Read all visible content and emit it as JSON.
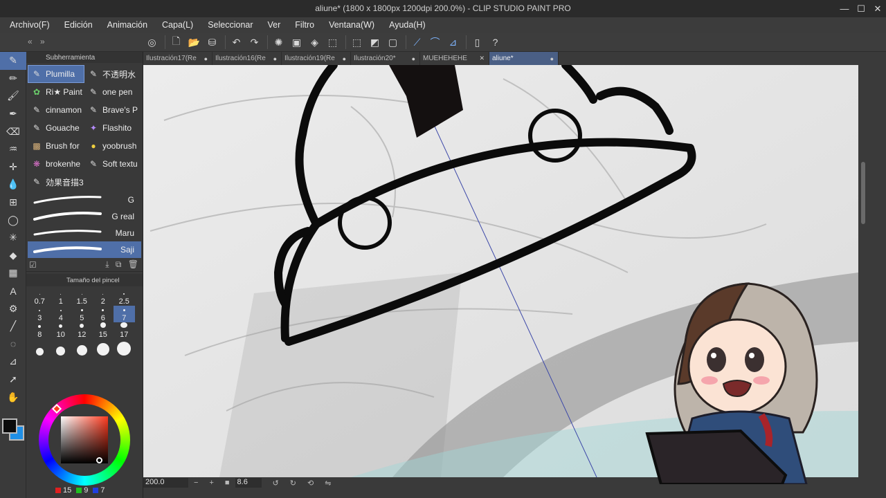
{
  "window": {
    "title": "aliune* (1800 x 1800px 1200dpi 200.0%)  - CLIP STUDIO PAINT PRO",
    "controls": [
      "—",
      "☐",
      "✕"
    ]
  },
  "menubar": [
    "Archivo(F)",
    "Edición",
    "Animación",
    "Capa(L)",
    "Seleccionar",
    "Ver",
    "Filtro",
    "Ventana(W)",
    "Ayuda(H)"
  ],
  "commandbar": {
    "nav": "« »"
  },
  "subtool_panel": {
    "header": "Subherramienta",
    "subtools": [
      {
        "label": "Plumilla",
        "icon": "pen-icon",
        "active": true
      },
      {
        "label": "不透明水",
        "icon": "pen-icon"
      },
      {
        "label": "Ri★ Paint",
        "icon": "leaf-icon"
      },
      {
        "label": "one pen",
        "icon": "pen-icon"
      },
      {
        "label": "cinnamon",
        "icon": "pen-icon"
      },
      {
        "label": "Brave's P",
        "icon": "pen-icon"
      },
      {
        "label": "Gouache",
        "icon": "pen-icon"
      },
      {
        "label": "Flashito",
        "icon": "sparkle-icon"
      },
      {
        "label": "Brush for",
        "icon": "brush-icon"
      },
      {
        "label": "yoobrush",
        "icon": "circle-icon"
      },
      {
        "label": "brokenhe",
        "icon": "heart-icon"
      },
      {
        "label": "Soft textu",
        "icon": "pen-icon"
      },
      {
        "label": "効果音描3",
        "icon": "pen-icon"
      }
    ],
    "strokes": [
      {
        "label": "G"
      },
      {
        "label": "G real"
      },
      {
        "label": "Maru"
      },
      {
        "label": "Saji",
        "active": true
      }
    ]
  },
  "brush_size": {
    "header": "Tamaño del pincel",
    "sizes": [
      "0.7",
      "1",
      "1.5",
      "2",
      "2.5",
      "3",
      "4",
      "5",
      "6",
      "7",
      "8",
      "10",
      "12",
      "15",
      "17",
      "",
      "",
      "",
      "",
      ""
    ],
    "selected": "7"
  },
  "color": {
    "foreground": "#0b0b0b",
    "background": "#1f8fe6",
    "rgb": {
      "r": "15",
      "g": "9",
      "b": "7"
    }
  },
  "tabs": [
    {
      "label": "Ilustración17(Re",
      "active": false
    },
    {
      "label": "Ilustración16(Re",
      "active": false
    },
    {
      "label": "Ilustración19(Re",
      "active": false
    },
    {
      "label": "Ilustración20*",
      "active": false
    },
    {
      "label": "MUEHEHEHE",
      "active": false,
      "close": "✕"
    },
    {
      "label": "aliune*",
      "active": true
    }
  ],
  "statusbar": {
    "zoom": "200.0",
    "angle": "8.6"
  }
}
